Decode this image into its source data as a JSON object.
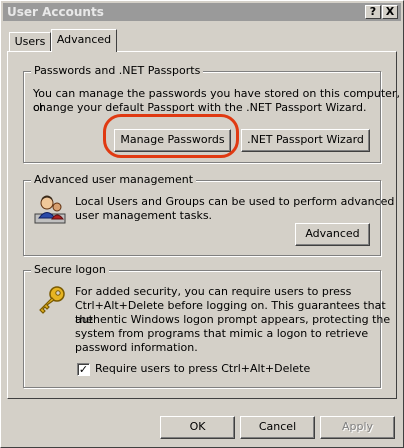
{
  "window": {
    "title": "User Accounts",
    "help_label": "?",
    "close_label": "X"
  },
  "tabs": [
    {
      "label": "Users",
      "active": false
    },
    {
      "label": "Advanced",
      "active": true
    }
  ],
  "groups": {
    "passwords": {
      "legend": "Passwords and .NET Passports",
      "line1": "You can manage the passwords you have stored on this computer, or",
      "line2": "change your default Passport with the .NET Passport Wizard.",
      "manage_button": "Manage Passwords",
      "wizard_button": ".NET Passport Wizard"
    },
    "advanced": {
      "legend": "Advanced user management",
      "line1": "Local Users and Groups can be used to perform advanced",
      "line2": "user management tasks.",
      "button": "Advanced"
    },
    "secure": {
      "legend": "Secure logon",
      "line1": "For added security, you can require users to press",
      "line2": "Ctrl+Alt+Delete before logging on. This guarantees that the",
      "line3": "authentic Windows logon prompt appears, protecting the",
      "line4": "system from programs that mimic a logon to retrieve",
      "line5": "password information.",
      "checkbox_label": "Require users to press Ctrl+Alt+Delete",
      "checkbox_checked": true
    }
  },
  "footer": {
    "ok": "OK",
    "cancel": "Cancel",
    "apply": "Apply"
  },
  "icons": {
    "users_icon": "users-icon",
    "key_icon": "key-icon"
  },
  "colors": {
    "highlight": "#e03a12",
    "titlebar": "#9a9a9a",
    "dialog": "#d4d0c8"
  }
}
